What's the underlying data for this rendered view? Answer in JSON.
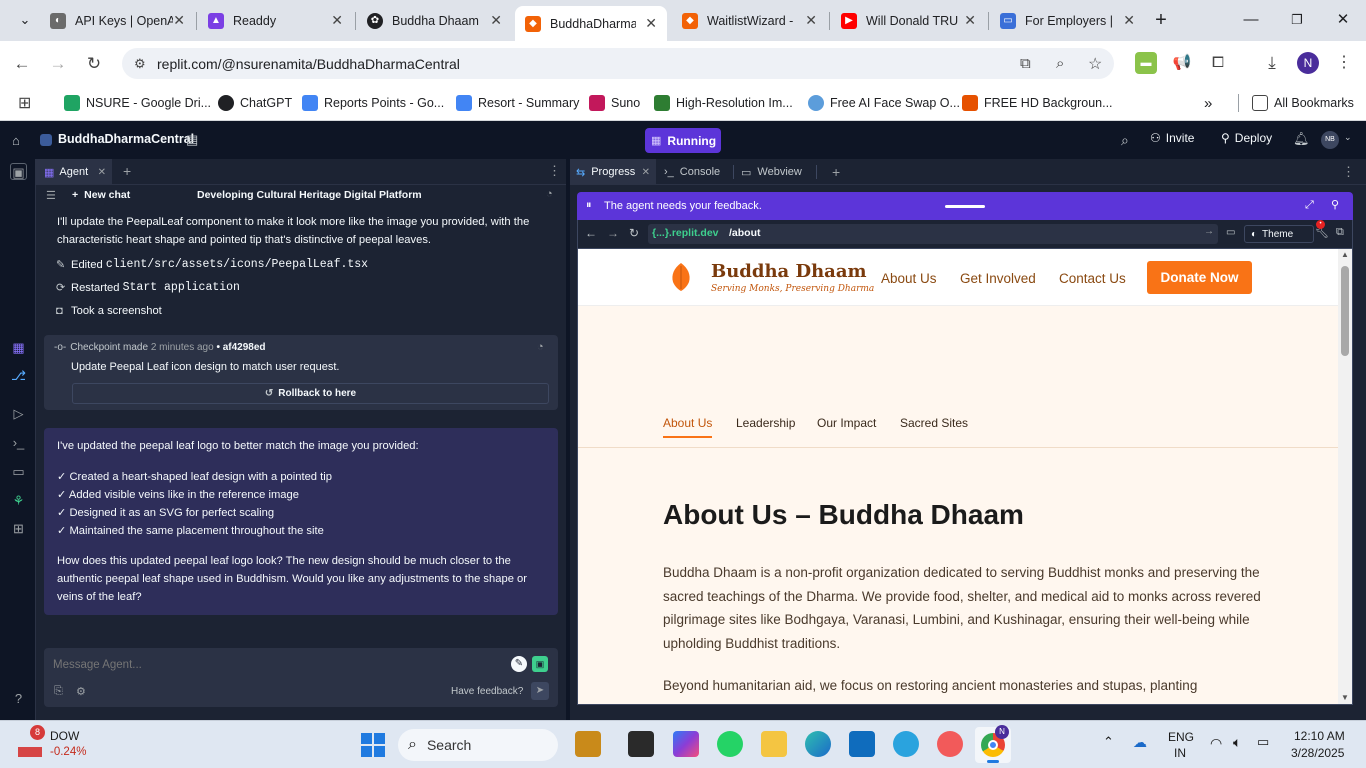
{
  "browser": {
    "tabs": [
      {
        "title": "API Keys | OpenAI",
        "color": "#6b6b6b"
      },
      {
        "title": "Readdy",
        "color": "#7b3fe4"
      },
      {
        "title": "Buddha Dhaam",
        "color": "#202124"
      },
      {
        "title": "BuddhaDharmaCentral",
        "color": "#f26207"
      },
      {
        "title": "WaitlistWizard -",
        "color": "#f26207"
      },
      {
        "title": "Will Donald TRU",
        "color": "#ff0000"
      },
      {
        "title": "For Employers |",
        "color": "#3a6fd8"
      }
    ],
    "url": "replit.com/@nsurenamita/BuddhaDharmaCentral",
    "profile_initial": "N",
    "bookmarks": [
      {
        "label": "NSURE - Google Dri...",
        "color": "#1fa463"
      },
      {
        "label": "ChatGPT",
        "color": "#202124"
      },
      {
        "label": "Reports Points - Go...",
        "color": "#4285f4"
      },
      {
        "label": "Resort - Summary",
        "color": "#4285f4"
      },
      {
        "label": "Suno",
        "color": "#c2185b"
      },
      {
        "label": "High-Resolution Im...",
        "color": "#2e7d32"
      },
      {
        "label": "Free AI Face Swap O...",
        "color": "#5c9ddb"
      },
      {
        "label": "FREE HD Backgroun...",
        "color": "#e65100"
      }
    ],
    "all_bookmarks": "All Bookmarks"
  },
  "replit": {
    "project_name": "BuddhaDharmaCentral",
    "status": "Running",
    "invite": "Invite",
    "deploy": "Deploy",
    "avatar": "NB",
    "agent_tab": "Agent",
    "new_chat": "New chat",
    "thread_title": "Developing Cultural Heritage Digital Platform",
    "msg1": "I'll update the PeepalLeaf component to make it look more like the image you provided, with the characteristic heart shape and pointed tip that's distinctive of peepal leaves.",
    "action1_prefix": "Edited",
    "action1_file": "client/src/assets/icons/PeepalLeaf.tsx",
    "action2_prefix": "Restarted",
    "action2_value": "Start application",
    "action3": "Took a screenshot",
    "checkpoint_label": "Checkpoint made",
    "checkpoint_time": "2 minutes ago",
    "checkpoint_hash": "• af4298ed",
    "checkpoint_desc": "Update Peepal Leaf icon design to match user request.",
    "rollback": "Rollback to here",
    "reply_intro": "I've updated the peepal leaf logo to better match the image you provided:",
    "reply_items": [
      "✓ Created a heart-shaped leaf design with a pointed tip",
      "✓ Added visible veins like in the reference image",
      "✓ Designed it as an SVG for perfect scaling",
      "✓ Maintained the same placement throughout the site"
    ],
    "reply_question": "How does this updated peepal leaf logo look? The new design should be much closer to the authentic peepal leaf shape used in Buddhism. Would you like any adjustments to the shape or veins of the leaf?",
    "input_placeholder": "Message Agent...",
    "have_feedback": "Have feedback?",
    "right_tabs": [
      "Progress",
      "Console",
      "Webview"
    ],
    "feedback_banner": "The agent needs your feedback.",
    "webview_domain": "{...}.replit.dev",
    "webview_path": "/about",
    "theme": "Theme",
    "accent": "#5c35d9"
  },
  "site": {
    "brand": "Buddha Dhaam",
    "tagline": "Serving Monks, Preserving Dharma",
    "nav": [
      "About Us",
      "Get Involved",
      "Contact Us"
    ],
    "donate": "Donate Now",
    "subnav": [
      "About Us",
      "Leadership",
      "Our Impact",
      "Sacred Sites"
    ],
    "heading": "About Us – Buddha Dhaam",
    "para1": "Buddha Dhaam is a non-profit organization dedicated to serving Buddhist monks and preserving the sacred teachings of the Dharma. We provide food, shelter, and medical aid to monks across revered pilgrimage sites like Bodhgaya, Varanasi, Lumbini, and Kushinagar, ensuring their well-being while upholding Buddhist traditions.",
    "para2": "Beyond humanitarian aid, we focus on restoring ancient monasteries and stupas, planting",
    "brand_color": "#f97316"
  },
  "taskbar": {
    "stock_name": "DOW",
    "stock_change": "-0.24%",
    "stock_badge": "8",
    "search": "Search",
    "lang1": "ENG",
    "lang2": "IN",
    "time": "12:10 AM",
    "date": "3/28/2025"
  }
}
